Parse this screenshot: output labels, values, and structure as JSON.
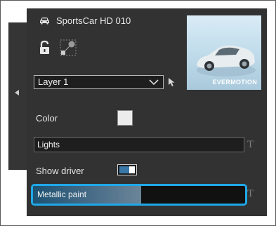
{
  "object": {
    "name": "SportsCar HD 010",
    "icon": "car-icon"
  },
  "toolbar": {
    "lock_icon": "unlock-icon",
    "pivot_icon": "pivot-icon"
  },
  "thumbnail": {
    "logo_text": "EVERMOTION"
  },
  "layer": {
    "selected": "Layer 1",
    "dropdown_icon": "chevron-down-icon",
    "picker_icon": "arrow-pointer-icon"
  },
  "properties": {
    "color_label": "Color",
    "color_value": "#ececec",
    "text_value": "Lights",
    "text_type_icon": "T",
    "show_driver_label": "Show driver",
    "show_driver_on": true,
    "slider_label": "Metallic paint",
    "slider_value": 0.51,
    "slider_type_icon": "T"
  },
  "colors": {
    "panel_bg": "#323232",
    "accent": "#1fa8e8",
    "toggle_on": "#3a78a8"
  }
}
